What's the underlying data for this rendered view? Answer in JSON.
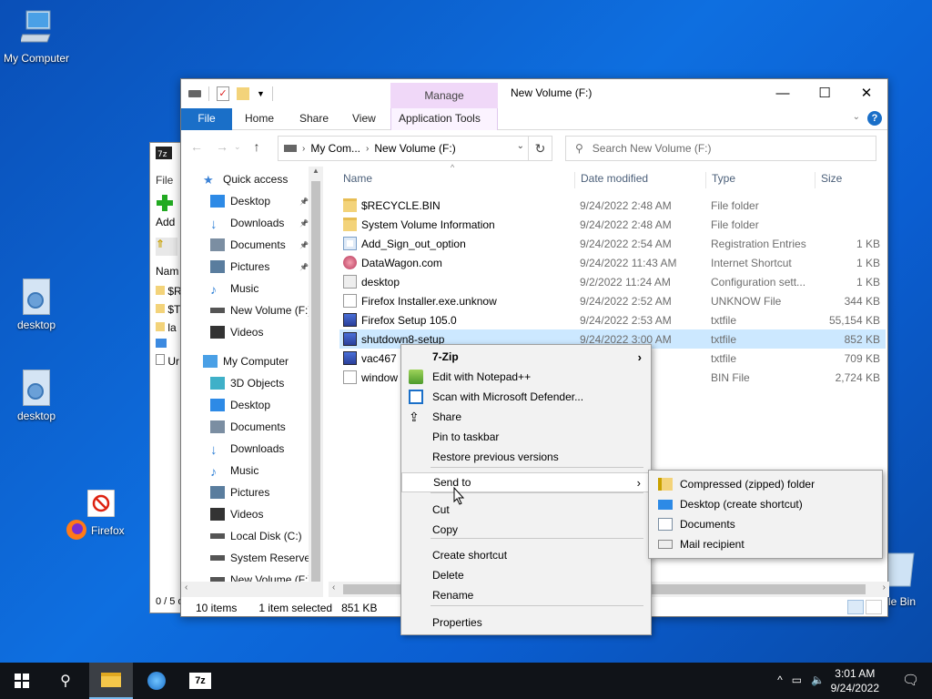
{
  "desktop": {
    "icons": [
      {
        "label": "My Computer"
      },
      {
        "label": "desktop"
      },
      {
        "label": "desktop"
      },
      {
        "label": "Firefox"
      },
      {
        "label": "le Bin"
      }
    ]
  },
  "sevenzip_window": {
    "file_label": "File",
    "add_label": "Add",
    "col_name": "Nam",
    "rows": [
      "$R",
      "$T",
      "la",
      "",
      "Ur"
    ],
    "status": "0 / 5 o"
  },
  "explorer": {
    "title": "New Volume (F:)",
    "context_tab": "Manage",
    "tabs": [
      "File",
      "Home",
      "Share",
      "View",
      "Application Tools"
    ],
    "address": {
      "parts": [
        "My Com...",
        "New Volume (F:)"
      ]
    },
    "search_placeholder": "Search New Volume (F:)",
    "nav": [
      {
        "label": "Quick access",
        "icon": "star-icon",
        "pin": false,
        "indent": 0
      },
      {
        "label": "Desktop",
        "icon": "desktop-folder-icon",
        "pin": true,
        "indent": 1
      },
      {
        "label": "Downloads",
        "icon": "download-icon",
        "pin": true,
        "indent": 1
      },
      {
        "label": "Documents",
        "icon": "documents-icon",
        "pin": true,
        "indent": 1
      },
      {
        "label": "Pictures",
        "icon": "pictures-icon",
        "pin": true,
        "indent": 1
      },
      {
        "label": "Music",
        "icon": "music-icon",
        "pin": false,
        "indent": 1
      },
      {
        "label": "New Volume (F:)",
        "icon": "drive-icon",
        "pin": false,
        "indent": 1
      },
      {
        "label": "Videos",
        "icon": "videos-icon",
        "pin": false,
        "indent": 1
      },
      {
        "label": "My Computer",
        "icon": "computer-icon",
        "pin": false,
        "indent": 0
      },
      {
        "label": "3D Objects",
        "icon": "cube-icon",
        "pin": false,
        "indent": 1
      },
      {
        "label": "Desktop",
        "icon": "desktop-folder-icon",
        "pin": false,
        "indent": 1
      },
      {
        "label": "Documents",
        "icon": "documents-icon",
        "pin": false,
        "indent": 1
      },
      {
        "label": "Downloads",
        "icon": "download-icon",
        "pin": false,
        "indent": 1
      },
      {
        "label": "Music",
        "icon": "music-icon",
        "pin": false,
        "indent": 1
      },
      {
        "label": "Pictures",
        "icon": "pictures-icon",
        "pin": false,
        "indent": 1
      },
      {
        "label": "Videos",
        "icon": "videos-icon",
        "pin": false,
        "indent": 1
      },
      {
        "label": "Local Disk (C:)",
        "icon": "drive-icon",
        "pin": false,
        "indent": 1
      },
      {
        "label": "System Reserved",
        "icon": "drive-icon",
        "pin": false,
        "indent": 1
      },
      {
        "label": "New Volume (F:)",
        "icon": "drive-icon",
        "pin": false,
        "indent": 1
      }
    ],
    "columns": {
      "name": "Name",
      "date": "Date modified",
      "type": "Type",
      "size": "Size"
    },
    "files": [
      {
        "name": "$RECYCLE.BIN",
        "date": "9/24/2022 2:48 AM",
        "type": "File folder",
        "size": "",
        "icon": "folder",
        "selected": false
      },
      {
        "name": "System Volume Information",
        "date": "9/24/2022 2:48 AM",
        "type": "File folder",
        "size": "",
        "icon": "folder",
        "selected": false
      },
      {
        "name": "Add_Sign_out_option",
        "date": "9/24/2022 2:54 AM",
        "type": "Registration Entries",
        "size": "1 KB",
        "icon": "reg",
        "selected": false
      },
      {
        "name": "DataWagon.com",
        "date": "9/24/2022 11:43 AM",
        "type": "Internet Shortcut",
        "size": "1 KB",
        "icon": "url",
        "selected": false
      },
      {
        "name": "desktop",
        "date": "9/2/2022 11:24 AM",
        "type": "Configuration sett...",
        "size": "1 KB",
        "icon": "ini",
        "selected": false
      },
      {
        "name": "Firefox Installer.exe.unknow",
        "date": "9/24/2022 2:52 AM",
        "type": "UNKNOW File",
        "size": "344 KB",
        "icon": "doc",
        "selected": false
      },
      {
        "name": "Firefox Setup 105.0",
        "date": "9/24/2022 2:53 AM",
        "type": "txtfile",
        "size": "55,154 KB",
        "icon": "setup",
        "selected": false
      },
      {
        "name": "shutdown8-setup",
        "date": "9/24/2022 3:00 AM",
        "type": "txtfile",
        "size": "852 KB",
        "icon": "setup",
        "selected": true
      },
      {
        "name": "vac467",
        "date": "",
        "type": "txtfile",
        "size": "709 KB",
        "icon": "setup",
        "selected": false
      },
      {
        "name": "window",
        "date": "",
        "type": "BIN File",
        "size": "2,724 KB",
        "icon": "doc",
        "selected": false
      }
    ],
    "status": {
      "count": "10 items",
      "selected": "1 item selected",
      "size": "851 KB"
    }
  },
  "context_menu": {
    "items": [
      {
        "label": "7-Zip",
        "bold": true,
        "submenu": true,
        "icon": ""
      },
      {
        "label": "Edit with Notepad++",
        "bold": false,
        "submenu": false,
        "icon": "notepadpp-icon"
      },
      {
        "label": "Scan with Microsoft Defender...",
        "bold": false,
        "submenu": false,
        "icon": "defender-icon"
      },
      {
        "label": "Share",
        "bold": false,
        "submenu": false,
        "icon": "share-icon"
      },
      {
        "label": "Pin to taskbar",
        "bold": false,
        "submenu": false,
        "icon": ""
      },
      {
        "label": "Restore previous versions",
        "bold": false,
        "submenu": false,
        "icon": ""
      },
      {
        "label": "Send to",
        "bold": false,
        "submenu": true,
        "icon": "",
        "highlight": true
      },
      {
        "label": "Cut",
        "bold": false,
        "submenu": false,
        "icon": ""
      },
      {
        "label": "Copy",
        "bold": false,
        "submenu": false,
        "icon": ""
      },
      {
        "label": "Create shortcut",
        "bold": false,
        "submenu": false,
        "icon": ""
      },
      {
        "label": "Delete",
        "bold": false,
        "submenu": false,
        "icon": ""
      },
      {
        "label": "Rename",
        "bold": false,
        "submenu": false,
        "icon": ""
      },
      {
        "label": "Properties",
        "bold": false,
        "submenu": false,
        "icon": ""
      }
    ]
  },
  "sendto_menu": {
    "items": [
      {
        "label": "Compressed (zipped) folder",
        "icon": "zip-folder-icon"
      },
      {
        "label": "Desktop (create shortcut)",
        "icon": "desktop-icon"
      },
      {
        "label": "Documents",
        "icon": "documents-icon"
      },
      {
        "label": "Mail recipient",
        "icon": "mail-icon"
      }
    ]
  },
  "taskbar": {
    "time": "3:01 AM",
    "date": "9/24/2022",
    "apps": [
      "start-icon",
      "search-icon",
      "file-explorer-icon",
      "app-icon",
      "7zip-icon"
    ]
  },
  "colors": {
    "accent": "#1a6fc8",
    "selection": "#cce8ff"
  }
}
